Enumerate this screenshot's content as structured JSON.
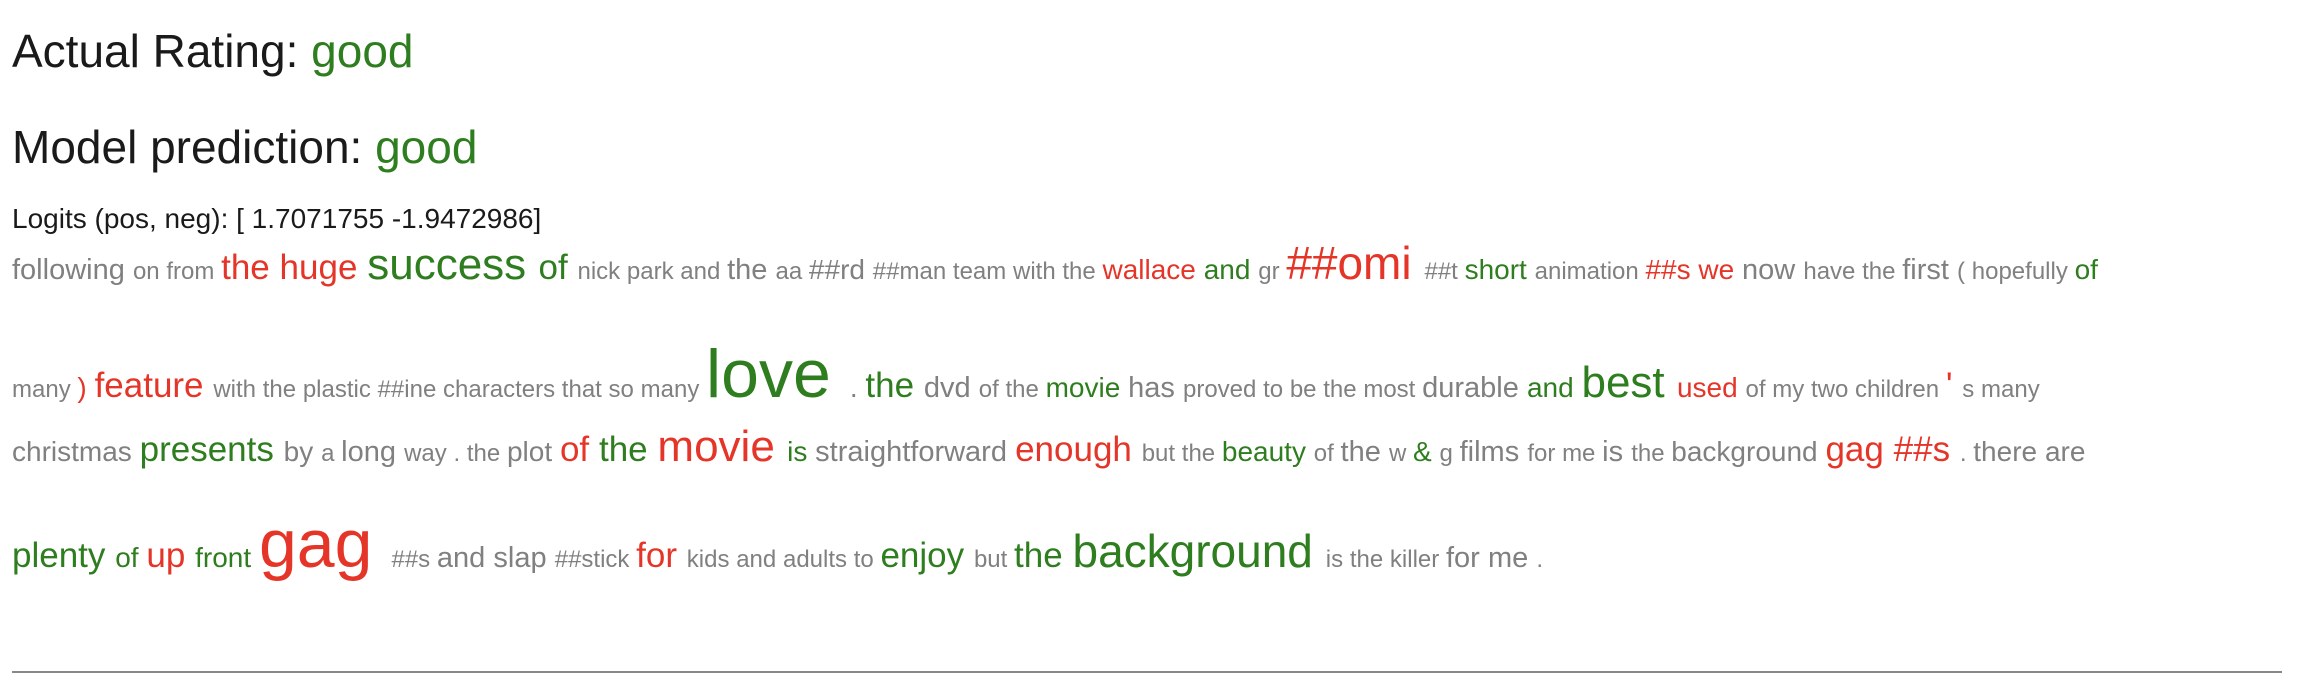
{
  "header": {
    "actual_label": "Actual Rating: ",
    "actual_value": "good",
    "prediction_label": "Model prediction: ",
    "prediction_value": "good",
    "logits_text": "Logits (pos, neg): [ 1.7071755 -1.9472986]"
  },
  "colors": {
    "positive": "#2e7d1f",
    "negative": "#e53528",
    "neutral": "#808080"
  },
  "token_lines": [
    [
      {
        "t": "following",
        "c": "neutral",
        "s": 29
      },
      {
        "t": "on",
        "c": "neutral",
        "s": 24
      },
      {
        "t": "from",
        "c": "neutral",
        "s": 24
      },
      {
        "t": "the",
        "c": "negative",
        "s": 35
      },
      {
        "t": "huge",
        "c": "negative",
        "s": 35
      },
      {
        "t": "success",
        "c": "positive",
        "s": 44
      },
      {
        "t": "of",
        "c": "positive",
        "s": 35
      },
      {
        "t": "nick",
        "c": "neutral",
        "s": 24
      },
      {
        "t": "park",
        "c": "neutral",
        "s": 24
      },
      {
        "t": "and",
        "c": "neutral",
        "s": 24
      },
      {
        "t": "the",
        "c": "neutral",
        "s": 29
      },
      {
        "t": "aa",
        "c": "neutral",
        "s": 24
      },
      {
        "t": "##rd",
        "c": "neutral",
        "s": 28
      },
      {
        "t": "##man",
        "c": "neutral",
        "s": 24
      },
      {
        "t": "team",
        "c": "neutral",
        "s": 24
      },
      {
        "t": "with",
        "c": "neutral",
        "s": 24
      },
      {
        "t": "the",
        "c": "neutral",
        "s": 24
      },
      {
        "t": "wallace",
        "c": "negative",
        "s": 28
      },
      {
        "t": "and",
        "c": "positive",
        "s": 28
      },
      {
        "t": "gr",
        "c": "neutral",
        "s": 24
      },
      {
        "t": "##omi",
        "c": "negative",
        "s": 46
      },
      {
        "t": "##t",
        "c": "neutral",
        "s": 24
      },
      {
        "t": "short",
        "c": "positive",
        "s": 28
      },
      {
        "t": "animation",
        "c": "neutral",
        "s": 24
      },
      {
        "t": "##s",
        "c": "negative",
        "s": 28
      },
      {
        "t": "we",
        "c": "negative",
        "s": 28
      },
      {
        "t": "now",
        "c": "neutral",
        "s": 29
      },
      {
        "t": "have",
        "c": "neutral",
        "s": 24
      },
      {
        "t": "the",
        "c": "neutral",
        "s": 24
      },
      {
        "t": "first",
        "c": "neutral",
        "s": 29
      },
      {
        "t": "(",
        "c": "neutral",
        "s": 24
      },
      {
        "t": "hopefully",
        "c": "neutral",
        "s": 24
      },
      {
        "t": "of",
        "c": "positive",
        "s": 28
      }
    ],
    [
      {
        "t": "many",
        "c": "neutral",
        "s": 24
      },
      {
        "t": ")",
        "c": "negative",
        "s": 28
      },
      {
        "t": "feature",
        "c": "negative",
        "s": 35
      },
      {
        "t": "with",
        "c": "neutral",
        "s": 24
      },
      {
        "t": "the",
        "c": "neutral",
        "s": 24
      },
      {
        "t": "plastic",
        "c": "neutral",
        "s": 24
      },
      {
        "t": "##ine",
        "c": "neutral",
        "s": 24
      },
      {
        "t": "characters",
        "c": "neutral",
        "s": 24
      },
      {
        "t": "that",
        "c": "neutral",
        "s": 24
      },
      {
        "t": "so",
        "c": "neutral",
        "s": 24
      },
      {
        "t": "many",
        "c": "neutral",
        "s": 24
      },
      {
        "t": "love",
        "c": "positive",
        "s": 68
      },
      {
        "t": ".",
        "c": "neutral",
        "s": 28
      },
      {
        "t": "the",
        "c": "positive",
        "s": 35
      },
      {
        "t": "dvd",
        "c": "neutral",
        "s": 29
      },
      {
        "t": "of",
        "c": "neutral",
        "s": 24
      },
      {
        "t": "the",
        "c": "neutral",
        "s": 24
      },
      {
        "t": "movie",
        "c": "positive",
        "s": 28
      },
      {
        "t": "has",
        "c": "neutral",
        "s": 29
      },
      {
        "t": "proved",
        "c": "neutral",
        "s": 24
      },
      {
        "t": "to",
        "c": "neutral",
        "s": 24
      },
      {
        "t": "be",
        "c": "neutral",
        "s": 24
      },
      {
        "t": "the",
        "c": "neutral",
        "s": 24
      },
      {
        "t": "most",
        "c": "neutral",
        "s": 24
      },
      {
        "t": "durable",
        "c": "neutral",
        "s": 29
      },
      {
        "t": "and",
        "c": "positive",
        "s": 28
      },
      {
        "t": "best",
        "c": "positive",
        "s": 44
      },
      {
        "t": "used",
        "c": "negative",
        "s": 28
      },
      {
        "t": "of",
        "c": "neutral",
        "s": 24
      },
      {
        "t": "my",
        "c": "neutral",
        "s": 24
      },
      {
        "t": "two",
        "c": "neutral",
        "s": 24
      },
      {
        "t": "children",
        "c": "neutral",
        "s": 24
      },
      {
        "t": "'",
        "c": "negative",
        "s": 35
      },
      {
        "t": "s",
        "c": "neutral",
        "s": 24
      },
      {
        "t": "many",
        "c": "neutral",
        "s": 24
      }
    ],
    [
      {
        "t": "christmas",
        "c": "neutral",
        "s": 28
      },
      {
        "t": "presents",
        "c": "positive",
        "s": 35
      },
      {
        "t": "by",
        "c": "neutral",
        "s": 28
      },
      {
        "t": "a",
        "c": "neutral",
        "s": 24
      },
      {
        "t": "long",
        "c": "neutral",
        "s": 29
      },
      {
        "t": "way",
        "c": "neutral",
        "s": 24
      },
      {
        "t": ".",
        "c": "neutral",
        "s": 24
      },
      {
        "t": "the",
        "c": "neutral",
        "s": 24
      },
      {
        "t": "plot",
        "c": "neutral",
        "s": 28
      },
      {
        "t": "of",
        "c": "negative",
        "s": 35
      },
      {
        "t": "the",
        "c": "positive",
        "s": 35
      },
      {
        "t": "movie",
        "c": "negative",
        "s": 44
      },
      {
        "t": "is",
        "c": "positive",
        "s": 28
      },
      {
        "t": "straightforward",
        "c": "neutral",
        "s": 29
      },
      {
        "t": "enough",
        "c": "negative",
        "s": 35
      },
      {
        "t": "but",
        "c": "neutral",
        "s": 24
      },
      {
        "t": "the",
        "c": "neutral",
        "s": 24
      },
      {
        "t": "beauty",
        "c": "positive",
        "s": 28
      },
      {
        "t": "of",
        "c": "neutral",
        "s": 24
      },
      {
        "t": "the",
        "c": "neutral",
        "s": 29
      },
      {
        "t": "w",
        "c": "neutral",
        "s": 24
      },
      {
        "t": "&",
        "c": "positive",
        "s": 28
      },
      {
        "t": "g",
        "c": "neutral",
        "s": 24
      },
      {
        "t": "films",
        "c": "neutral",
        "s": 29
      },
      {
        "t": "for",
        "c": "neutral",
        "s": 24
      },
      {
        "t": "me",
        "c": "neutral",
        "s": 24
      },
      {
        "t": "is",
        "c": "neutral",
        "s": 29
      },
      {
        "t": "the",
        "c": "neutral",
        "s": 24
      },
      {
        "t": "background",
        "c": "neutral",
        "s": 28
      },
      {
        "t": "gag",
        "c": "negative",
        "s": 35
      },
      {
        "t": "##s",
        "c": "negative",
        "s": 35
      },
      {
        "t": ".",
        "c": "neutral",
        "s": 24
      },
      {
        "t": "there",
        "c": "neutral",
        "s": 28
      },
      {
        "t": "are",
        "c": "neutral",
        "s": 28
      }
    ],
    [
      {
        "t": "plenty",
        "c": "positive",
        "s": 35
      },
      {
        "t": "of",
        "c": "positive",
        "s": 28
      },
      {
        "t": "up",
        "c": "negative",
        "s": 35
      },
      {
        "t": "front",
        "c": "positive",
        "s": 28
      },
      {
        "t": "gag",
        "c": "negative",
        "s": 68
      },
      {
        "t": "##s",
        "c": "neutral",
        "s": 24
      },
      {
        "t": "and",
        "c": "neutral",
        "s": 29
      },
      {
        "t": "slap",
        "c": "neutral",
        "s": 29
      },
      {
        "t": "##stick",
        "c": "neutral",
        "s": 24
      },
      {
        "t": "for",
        "c": "negative",
        "s": 35
      },
      {
        "t": "kids",
        "c": "neutral",
        "s": 24
      },
      {
        "t": "and",
        "c": "neutral",
        "s": 24
      },
      {
        "t": "adults",
        "c": "neutral",
        "s": 24
      },
      {
        "t": "to",
        "c": "neutral",
        "s": 24
      },
      {
        "t": "enjoy",
        "c": "positive",
        "s": 35
      },
      {
        "t": "but",
        "c": "neutral",
        "s": 24
      },
      {
        "t": "the",
        "c": "positive",
        "s": 35
      },
      {
        "t": "background",
        "c": "positive",
        "s": 46
      },
      {
        "t": "is",
        "c": "neutral",
        "s": 24
      },
      {
        "t": "the",
        "c": "neutral",
        "s": 24
      },
      {
        "t": "killer",
        "c": "neutral",
        "s": 24
      },
      {
        "t": "for",
        "c": "neutral",
        "s": 29
      },
      {
        "t": "me",
        "c": "neutral",
        "s": 29
      },
      {
        "t": ".",
        "c": "neutral",
        "s": 24
      }
    ]
  ]
}
